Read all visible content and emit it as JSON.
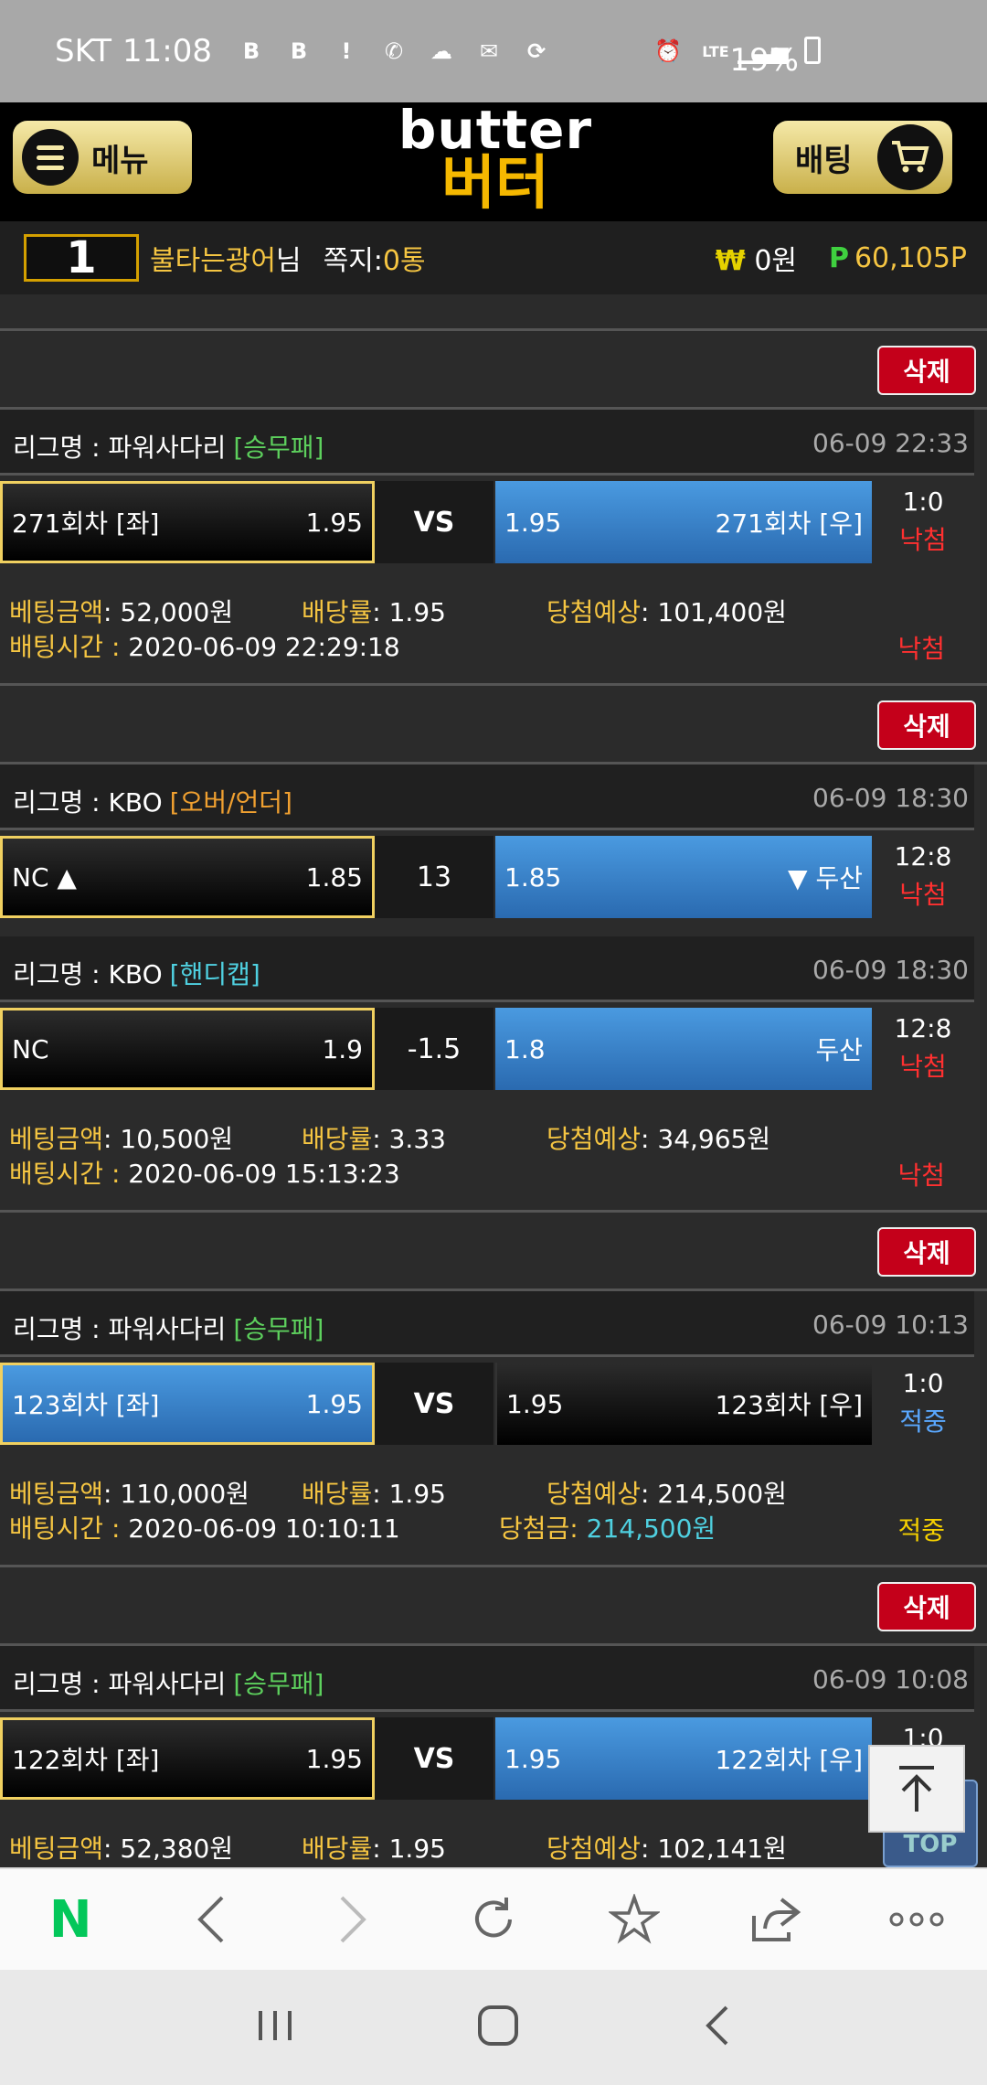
{
  "status_bar": {
    "carrier": "SKT",
    "time": "11:08",
    "network": "LTE",
    "battery": "19%"
  },
  "header": {
    "menu_label": "메뉴",
    "logo_en": "butter",
    "logo_ko": "버터",
    "bet_label": "배팅"
  },
  "user": {
    "level": "1",
    "name": "불타는광어",
    "suffix": "님",
    "note_label": "쪽지:",
    "note_count": "0통",
    "won_symbol": "₩",
    "won": "0원",
    "point_symbol": "P",
    "points": "60,105P"
  },
  "labels": {
    "league": "리그명 : ",
    "delete": "삭제",
    "vs": "VS",
    "bet_amount": "베팅금액",
    "odds": "배당률",
    "expected": "당첨예상",
    "bet_time": "배팅시간 : ",
    "win_amount": "당첨금: "
  },
  "bets": [
    {
      "leagues": [
        {
          "league": "파워사다리",
          "type": "[승무패]",
          "date": "06-09 22:33",
          "home": "271회차 [좌]",
          "home_odds": "1.95",
          "center": "VS",
          "away_odds": "1.95",
          "away": "271회차 [우]",
          "score": "1:0",
          "status": "낙첨"
        }
      ],
      "amount": ": 52,000원",
      "rate": ": 1.95",
      "expected": ": 101,400원",
      "time": "2020-06-09 22:29:18",
      "final": "낙첨"
    },
    {
      "leagues": [
        {
          "league": "KBO",
          "type": "[오버/언더]",
          "date": "06-09 18:30",
          "home": "NC ▲",
          "home_odds": "1.85",
          "center": "13",
          "away_odds": "1.85",
          "away": "▼ 두산",
          "score": "12:8",
          "status": "낙첨"
        },
        {
          "league": "KBO",
          "type": "[핸디캡]",
          "date": "06-09 18:30",
          "home": "NC",
          "home_odds": "1.9",
          "center": "-1.5",
          "away_odds": "1.8",
          "away": "두산",
          "score": "12:8",
          "status": "낙첨"
        }
      ],
      "amount": ": 10,500원",
      "rate": ": 3.33",
      "expected": ": 34,965원",
      "time": "2020-06-09 15:13:23",
      "final": "낙첨"
    },
    {
      "leagues": [
        {
          "league": "파워사다리",
          "type": "[승무패]",
          "date": "06-09 10:13",
          "home": "123회차 [좌]",
          "home_odds": "1.95",
          "center": "VS",
          "away_odds": "1.95",
          "away": "123회차 [우]",
          "score": "1:0",
          "status": "적중"
        }
      ],
      "amount": ": 110,000원",
      "rate": ": 1.95",
      "expected": ": 214,500원",
      "time": "2020-06-09 10:10:11",
      "win_value": "214,500원",
      "final": "적중"
    },
    {
      "leagues": [
        {
          "league": "파워사다리",
          "type": "[승무패]",
          "date": "06-09 10:08",
          "home": "122회차 [좌]",
          "home_odds": "1.95",
          "center": "VS",
          "away_odds": "1.95",
          "away": "122회차 [우]",
          "score": "1:0"
        }
      ],
      "amount": ": 52,380원",
      "rate": ": 1.95",
      "expected": ": 102,141원"
    }
  ],
  "top_button": "TOP",
  "browser_bar": {
    "icons": [
      "naver-icon",
      "back-icon",
      "forward-icon",
      "refresh-icon",
      "star-icon",
      "share-icon",
      "more-icon"
    ]
  },
  "colors": {
    "accent_gold": "#f5c542",
    "delete_red": "#c4001a",
    "blue_selection": "#3a80c8",
    "naver_green": "#03c75a"
  }
}
